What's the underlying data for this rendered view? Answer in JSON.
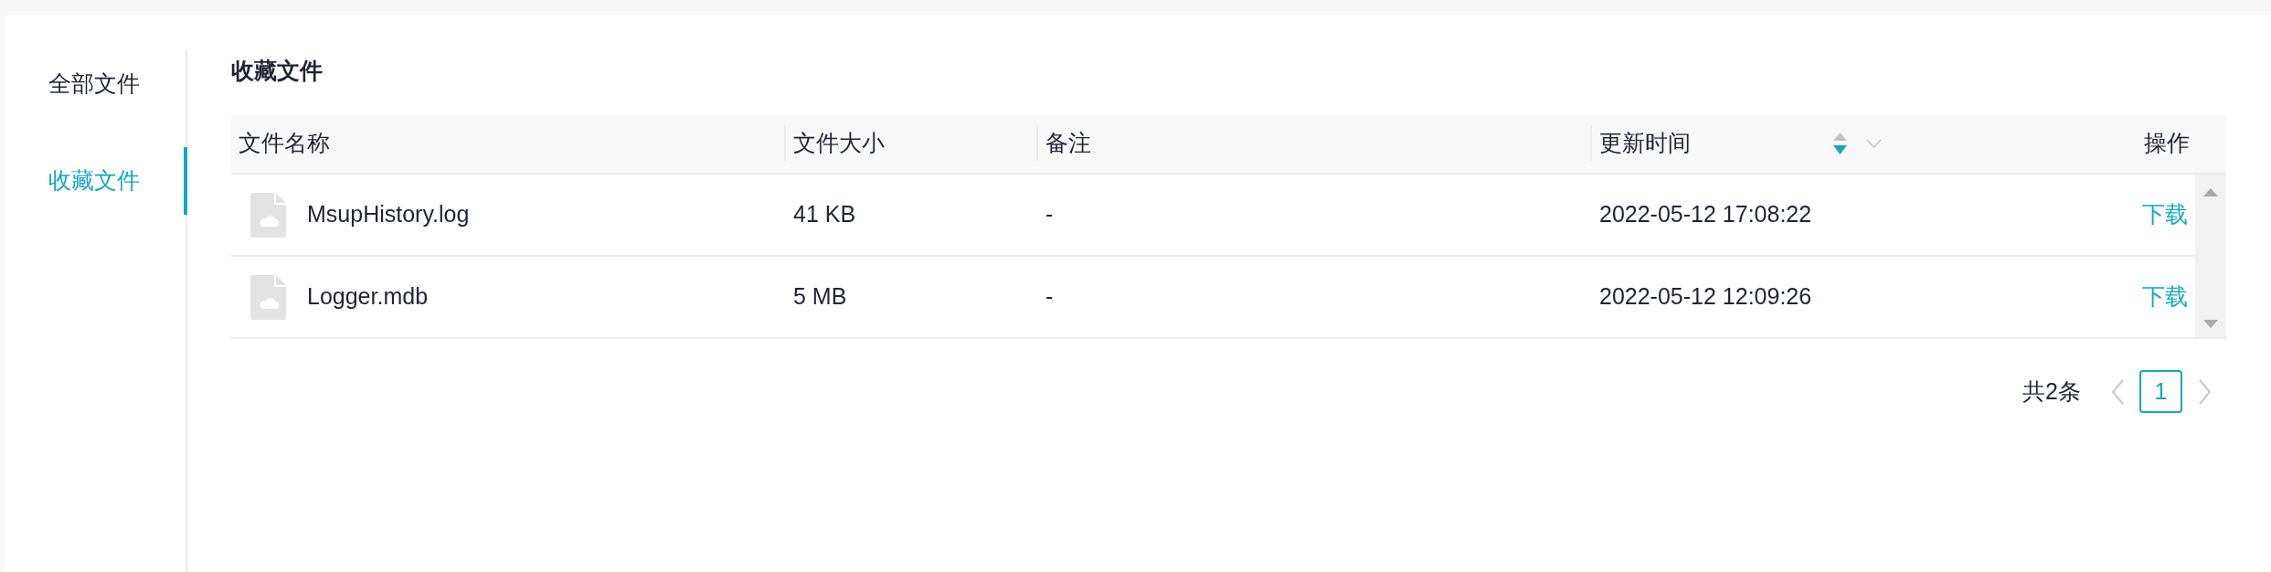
{
  "sidebar": {
    "items": [
      {
        "label": "全部文件",
        "selected": false
      },
      {
        "label": "收藏文件",
        "selected": true
      }
    ]
  },
  "page_title": "收藏文件",
  "table": {
    "columns": [
      {
        "label": "文件名称"
      },
      {
        "label": "文件大小"
      },
      {
        "label": "备注"
      },
      {
        "label": "更新时间",
        "sortable": true,
        "sort_asc": false,
        "sort_desc": true,
        "filter": true
      },
      {
        "label": "操作"
      }
    ],
    "rows": [
      {
        "name": "MsupHistory.log",
        "size": "41 KB",
        "note": "-",
        "updated": "2022-05-12 17:08:22",
        "action": "下载"
      },
      {
        "name": "Logger.mdb",
        "size": "5 MB",
        "note": "-",
        "updated": "2022-05-12 12:09:26",
        "action": "下载"
      }
    ]
  },
  "pagination": {
    "total": "共2条",
    "prev_disabled": true,
    "pages": [
      {
        "label": "1",
        "selected": true
      }
    ],
    "next_disabled": true
  }
}
